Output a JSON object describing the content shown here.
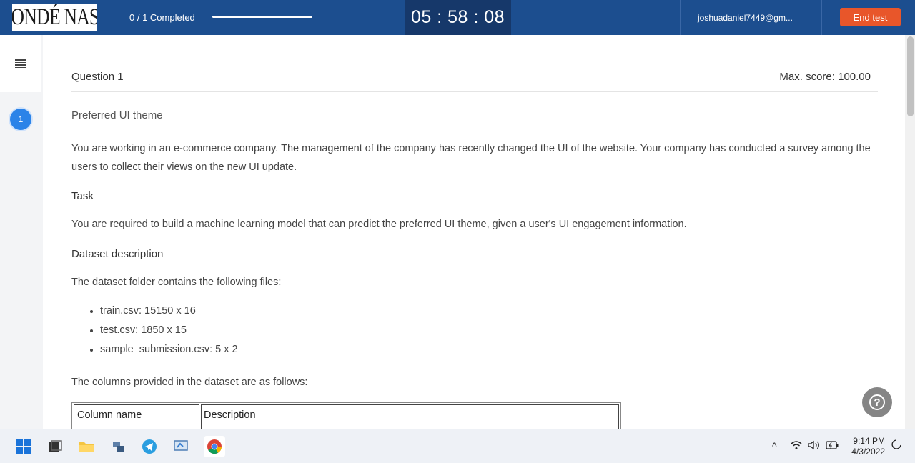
{
  "header": {
    "logo_text": "CONDÉ NAST",
    "progress_label": "0 / 1 Completed",
    "progress_fraction": 1.0,
    "timer": "05 : 58 : 08",
    "user_email": "joshuadaniel7449@gm...",
    "end_test_label": "End test"
  },
  "sidebar": {
    "question_number": "1"
  },
  "question": {
    "title": "Question  1",
    "max_score": "Max. score: 100.00",
    "subtitle": "Preferred UI theme",
    "intro": "You are working in an e-commerce company. The management of the company has recently changed the UI of the website. Your company has conducted a survey among the users to collect their views on the new UI update.",
    "task_heading": "Task",
    "task_text": "You are required to build a machine learning model that can predict the preferred UI theme, given a user's UI engagement information.",
    "dataset_heading": "Dataset description",
    "dataset_intro": "The dataset folder contains the following files:",
    "files": [
      "train.csv:  15150 x 16",
      "test.csv:  1850 x 15",
      "sample_submission.csv: 5 x 2"
    ],
    "columns_intro": "The columns provided in the dataset are as follows:",
    "table_headers": [
      "Column name",
      "Description"
    ]
  },
  "taskbar": {
    "time": "9:14 PM",
    "date": "4/3/2022"
  },
  "colors": {
    "header_bg": "#1c4e8f",
    "timer_bg": "#16386a",
    "end_button": "#e8562a",
    "badge": "#2b83e8"
  },
  "icons": [
    "menu-icon",
    "help-icon",
    "windows-start-icon",
    "file-explorer-icon",
    "telegram-icon",
    "chrome-icon",
    "wifi-icon",
    "speaker-icon",
    "battery-icon"
  ]
}
